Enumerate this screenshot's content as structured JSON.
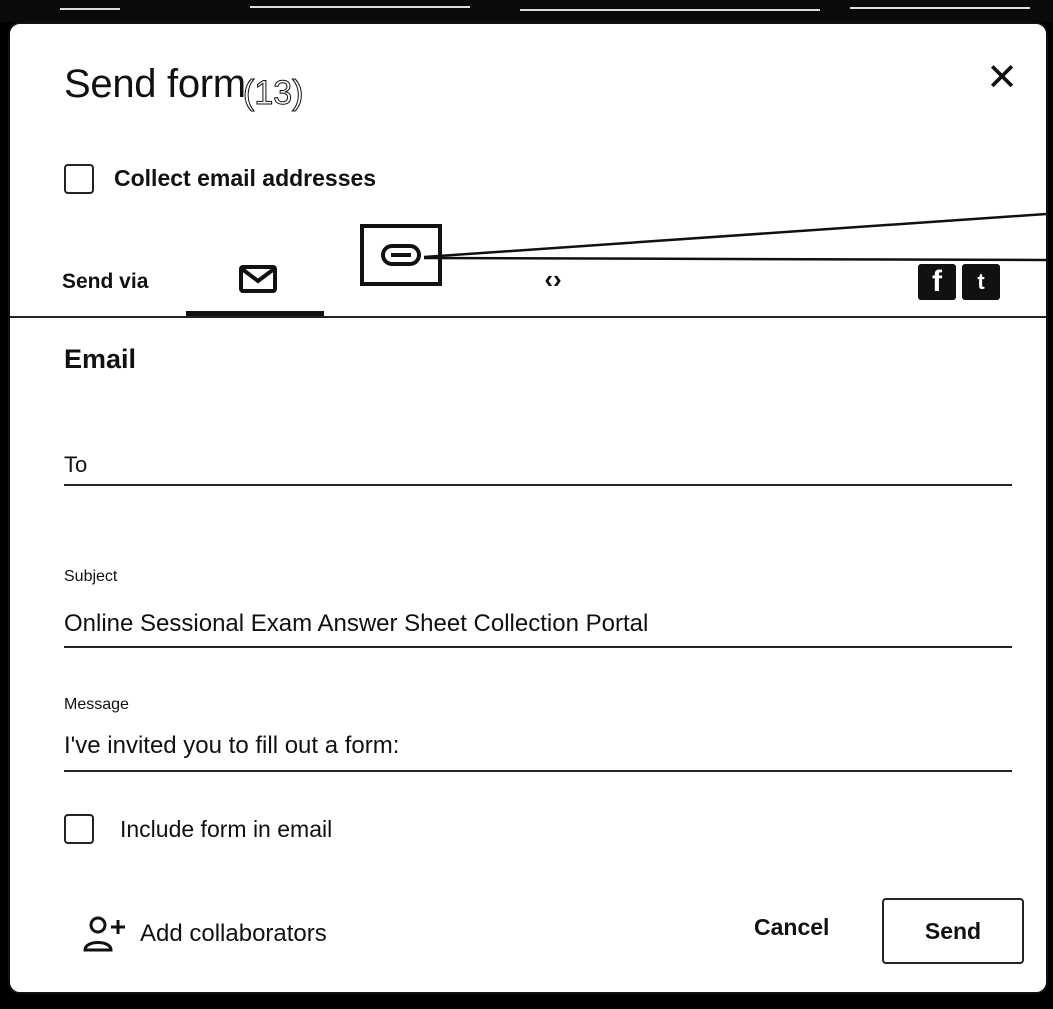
{
  "dialog": {
    "title": "Send form",
    "annotation": "(13)",
    "close_icon": "close-icon"
  },
  "collect_email": {
    "label": "Collect email addresses",
    "checked": false
  },
  "send_via": {
    "label": "Send via",
    "tabs": [
      {
        "name": "email",
        "icon": "mail-icon",
        "selected": true
      },
      {
        "name": "link",
        "icon": "link-icon",
        "selected": false,
        "highlighted": true
      },
      {
        "name": "embed",
        "icon": "embed-icon",
        "glyph": "<>",
        "selected": false
      },
      {
        "name": "facebook",
        "icon": "facebook-icon",
        "glyph": "f",
        "selected": false
      },
      {
        "name": "twitter",
        "icon": "twitter-icon",
        "glyph": "t",
        "selected": false
      }
    ]
  },
  "email_section": {
    "heading": "Email",
    "to": {
      "label": "To",
      "value": ""
    },
    "subject": {
      "label": "Subject",
      "value": "Online Sessional Exam Answer Sheet Collection Portal"
    },
    "message": {
      "label": "Message",
      "value": "I've invited you to fill out a form:"
    },
    "include_form": {
      "label": "Include form in email",
      "checked": false
    }
  },
  "footer": {
    "add_collaborators": "Add collaborators",
    "add_collaborators_icon": "person-add-icon",
    "cancel": "Cancel",
    "send": "Send"
  },
  "colors": {
    "background": "#000000",
    "dialog": "#ffffff",
    "text": "#111111"
  }
}
